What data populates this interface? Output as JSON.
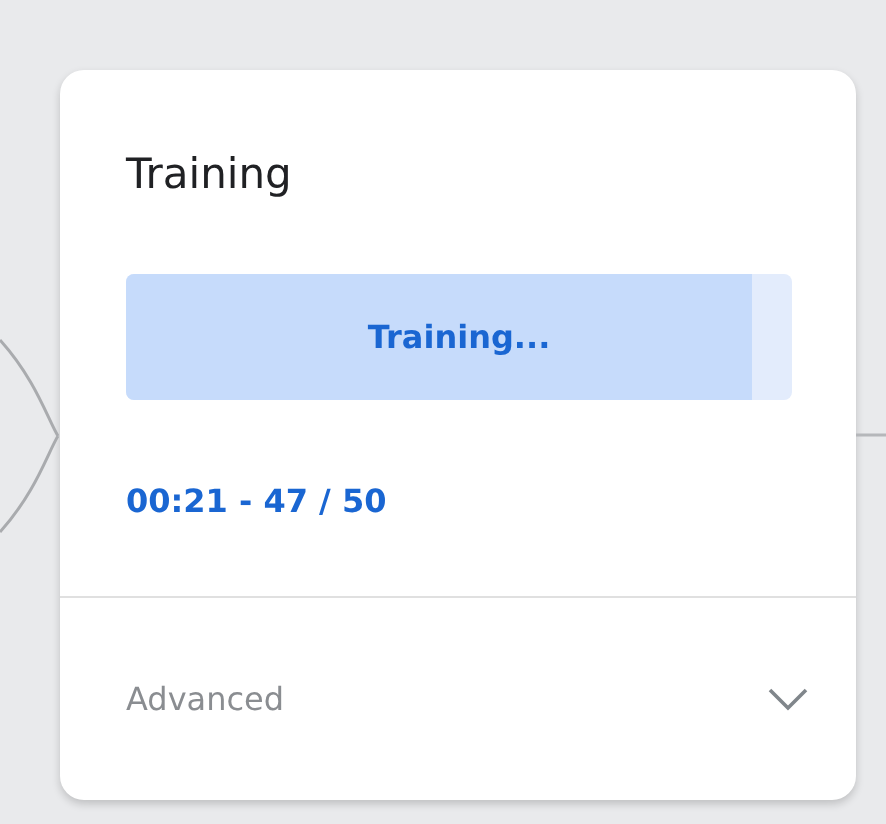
{
  "card": {
    "title": "Training",
    "progress": {
      "label": "Training...",
      "level": 0.94
    },
    "status": "00:21 - 47 / 50",
    "advanced": {
      "label": "Advanced",
      "expanded": false
    }
  }
}
